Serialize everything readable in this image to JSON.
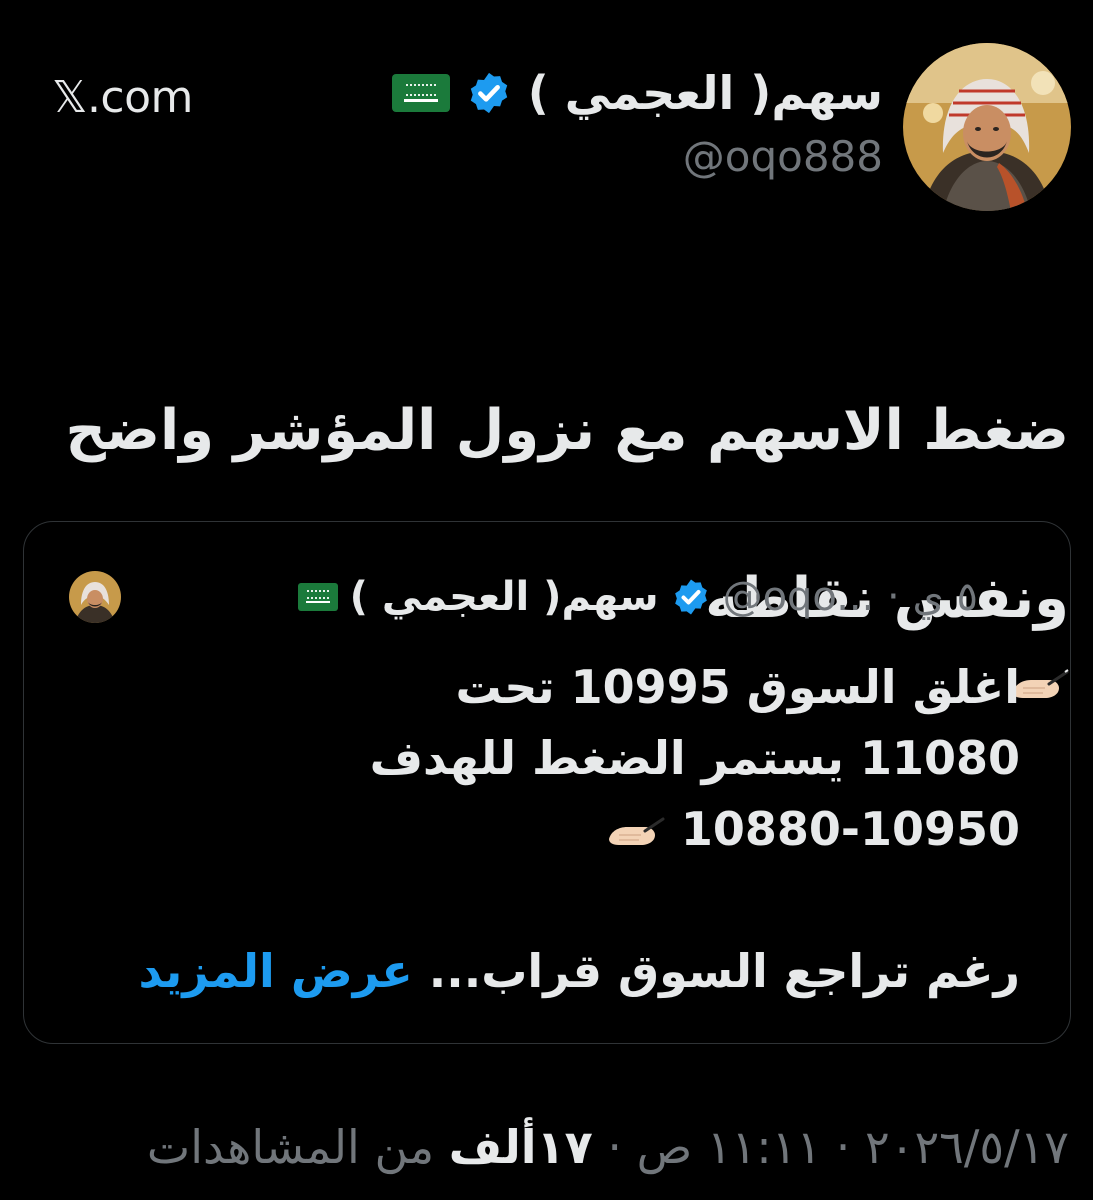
{
  "site": "𝕏.com",
  "author": {
    "display_name": "سهم( العجمي )",
    "handle": "@oqo888"
  },
  "tweet": {
    "line1": "ضغط الاسهم مع نزول المؤشر واضح",
    "line2": "ونفس نقاطه"
  },
  "quoted": {
    "display_name": "سهم( العجمي )",
    "meta": "@oqo... · ٥ ي",
    "lines": [
      "اغلق السوق 10995 تحت",
      "11080 يستمر الضغط للهدف",
      "10880-10950"
    ],
    "truncated_text": "رغم تراجع السوق قراب...",
    "show_more": "عرض المزيد"
  },
  "footer": {
    "date": "٢٠٢٦/٥/١٧",
    "sep1": " · ",
    "time": "١١:١١ ص",
    "sep2": " · ",
    "views_count": "١٧ألف",
    "views_label": " من المشاهدات"
  },
  "colors": {
    "background": "#000000",
    "text": "#e7e9ea",
    "muted": "#71767b",
    "link": "#1d9bf0",
    "verified": "#1d9bf0",
    "flag": "#1b7a3b"
  },
  "icons": {
    "verified": "verified-badge-icon",
    "flag": "saudi-flag-icon",
    "writing_hand": "writing-hand-icon"
  }
}
